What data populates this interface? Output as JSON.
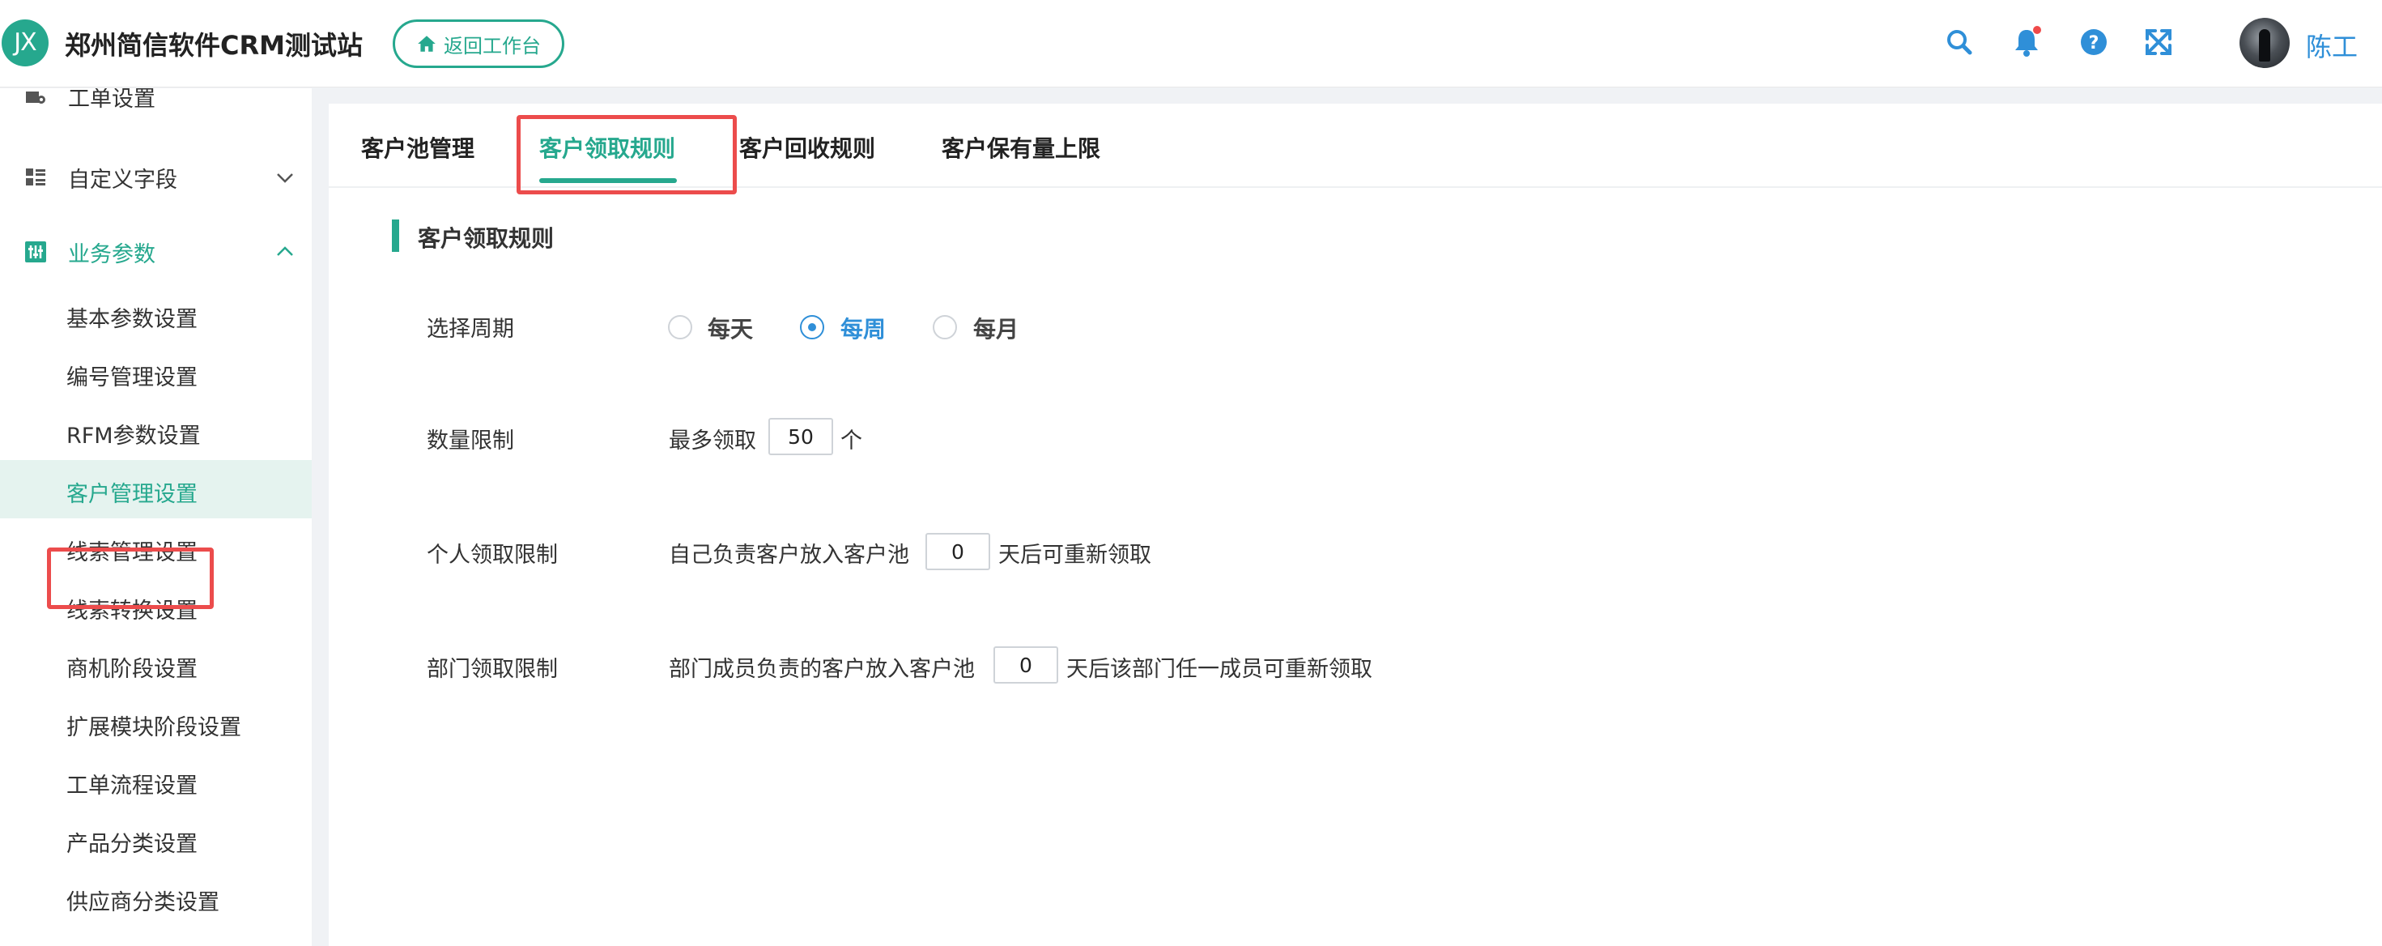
{
  "header": {
    "logo_text": "JX",
    "app_title": "郑州简信软件CRM测试站",
    "back_button_label": "返回工作台",
    "user_name": "陈工",
    "icons": [
      "search-icon",
      "bell-icon",
      "help-icon",
      "fullscreen-icon"
    ],
    "accent_color": "#26a88e",
    "link_color": "#2f8fd8",
    "badge_color": "#f04a4a"
  },
  "sidebar": {
    "partial_top_item": "工单设置",
    "groups": [
      {
        "label": "自定义字段",
        "expanded": false
      },
      {
        "label": "业务参数",
        "expanded": true
      }
    ],
    "items": [
      {
        "label": "基本参数设置"
      },
      {
        "label": "编号管理设置"
      },
      {
        "label": "RFM参数设置"
      },
      {
        "label": "客户管理设置",
        "active": true
      },
      {
        "label": "线索管理设置"
      },
      {
        "label": "线索转换设置"
      },
      {
        "label": "商机阶段设置"
      },
      {
        "label": "扩展模块阶段设置"
      },
      {
        "label": "工单流程设置"
      },
      {
        "label": "产品分类设置"
      },
      {
        "label": "供应商分类设置"
      }
    ]
  },
  "main": {
    "tabs": [
      {
        "label": "客户池管理"
      },
      {
        "label": "客户领取规则",
        "active": true
      },
      {
        "label": "客户回收规则"
      },
      {
        "label": "客户保有量上限"
      }
    ],
    "section_title": "客户领取规则",
    "period": {
      "label": "选择周期",
      "options": [
        "每天",
        "每周",
        "每月"
      ],
      "selected": "每周"
    },
    "quantity_limit": {
      "label": "数量限制",
      "prefix": "最多领取",
      "value": "50",
      "suffix": "个"
    },
    "personal_limit": {
      "label": "个人领取限制",
      "prefix": "自己负责客户放入客户池",
      "value": "0",
      "suffix": "天后可重新领取"
    },
    "department_limit": {
      "label": "部门领取限制",
      "prefix": "部门成员负责的客户放入客户池",
      "value": "0",
      "suffix": "天后该部门任一成员可重新领取"
    }
  }
}
